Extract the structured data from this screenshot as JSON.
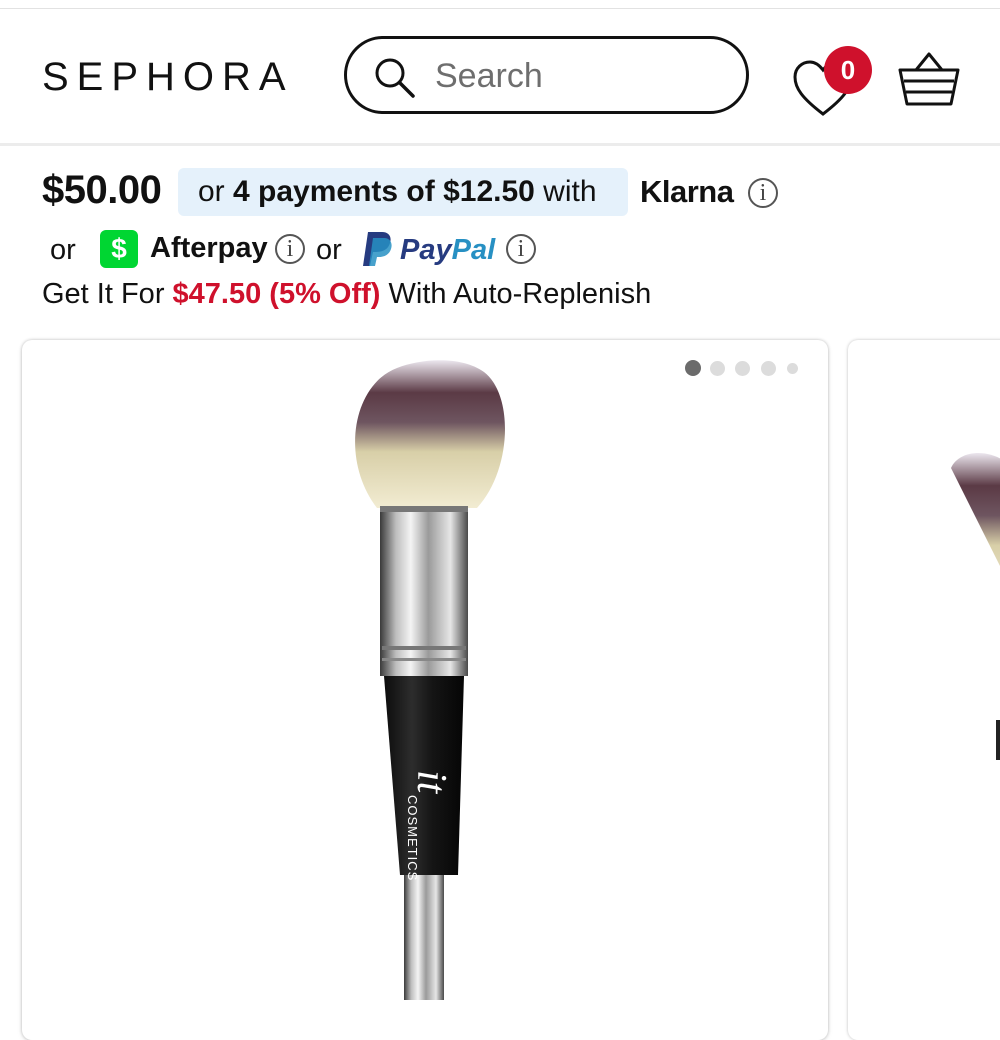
{
  "header": {
    "brand": "SEPHORA",
    "search_placeholder": "Search",
    "loves_count": "0"
  },
  "pricing": {
    "price": "$50.00",
    "klarna_text_pre": "or ",
    "klarna_text_bold": "4 payments of $12.50",
    "klarna_text_post": " with",
    "klarna_brand": "Klarna",
    "or_1": "or",
    "afterpay_icon": "$",
    "afterpay_brand": "Afterpay",
    "or_2": "or",
    "paypal_brand_a": "Pay",
    "paypal_brand_b": "Pal",
    "info_glyph": "i",
    "replenish_pre": "Get It For ",
    "replenish_highlight": "$47.50 (5% Off)",
    "replenish_post": " With Auto-Replenish"
  },
  "product_image": {
    "brand_mark": "it",
    "brand_text": "COSMETICS"
  },
  "carousel": {
    "total_dots": 5,
    "active_index": 0
  },
  "colors": {
    "accent_red": "#cf112c",
    "klarna_bg": "#e5f1fb",
    "afterpay_green": "#00d632",
    "paypal_dark": "#263b80",
    "paypal_light": "#2790c3"
  },
  "icons": [
    "search-icon",
    "heart-icon",
    "basket-icon",
    "info-icon",
    "afterpay-icon",
    "paypal-icon"
  ]
}
